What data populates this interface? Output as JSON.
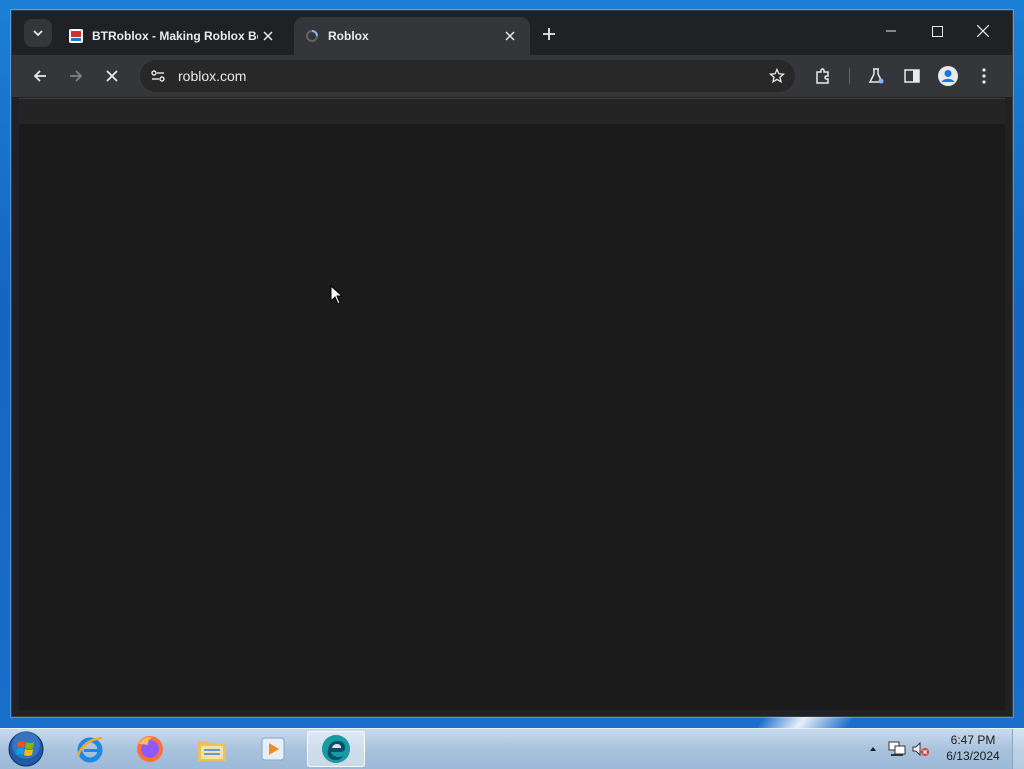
{
  "browser": {
    "tabs": [
      {
        "title": "BTRoblox - Making Roblox Bet",
        "active": false
      },
      {
        "title": "Roblox",
        "active": true
      }
    ],
    "address": "roblox.com"
  },
  "taskbar": {
    "apps": [
      "internet-explorer",
      "firefox",
      "file-explorer",
      "media-player",
      "edge"
    ],
    "clock_time": "6:47 PM",
    "clock_date": "6/13/2024"
  },
  "colors": {
    "page_background": "#1b1b1b",
    "tab_active": "#35363a",
    "tabstrip": "#202124"
  }
}
